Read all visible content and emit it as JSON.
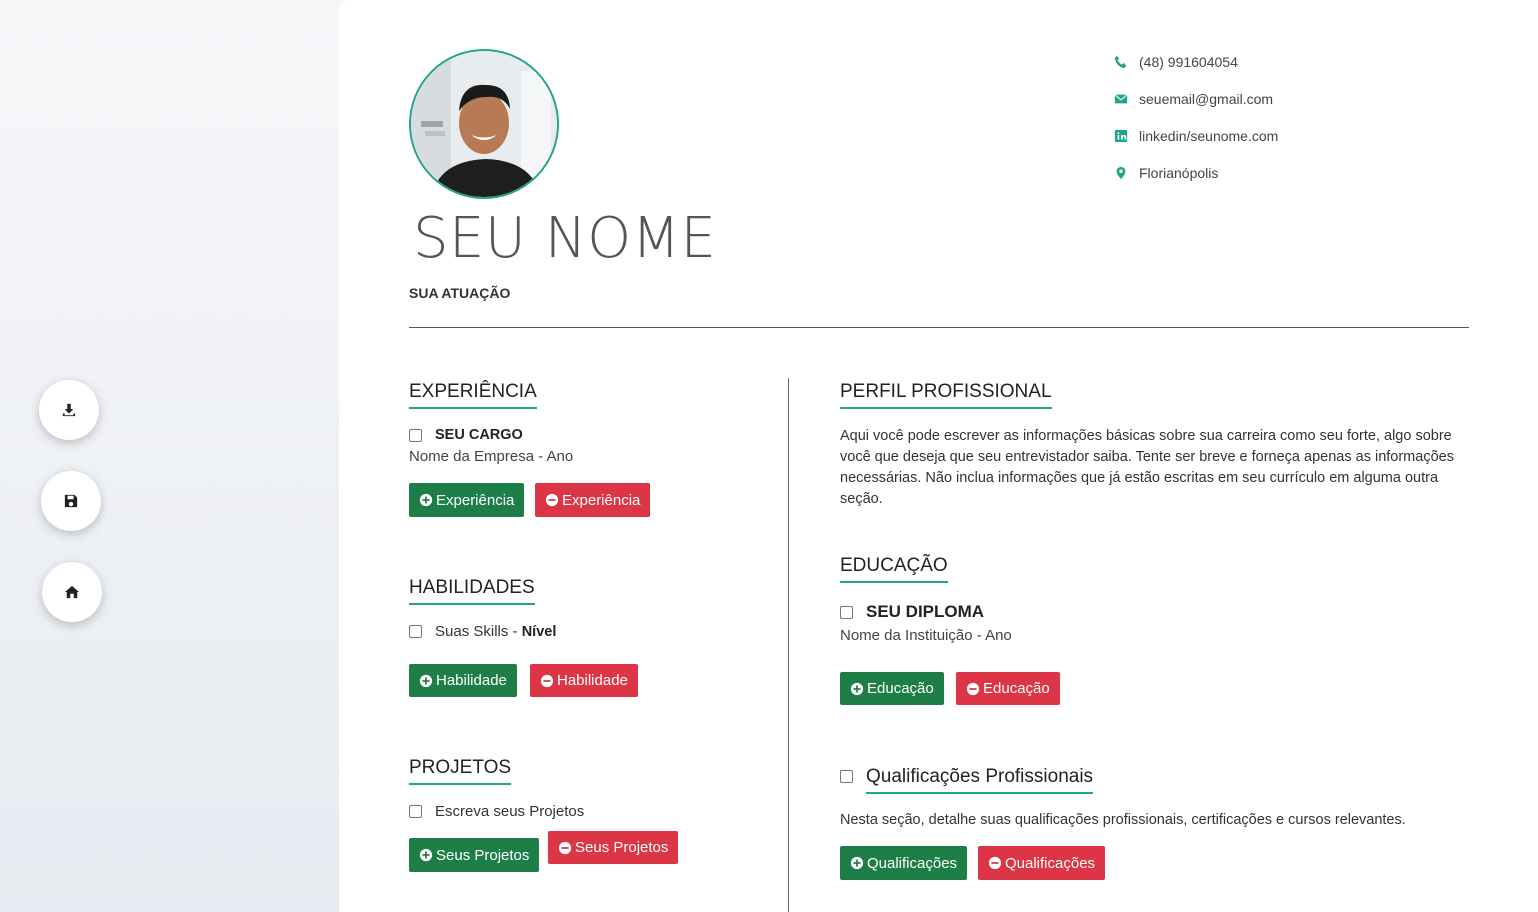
{
  "sidebar": {
    "buttons": [
      {
        "icon": "download-icon"
      },
      {
        "icon": "save-icon"
      },
      {
        "icon": "home-icon"
      }
    ]
  },
  "header": {
    "name": "SEU NOME",
    "role": "SUA ATUAÇÃO",
    "contacts": [
      {
        "icon": "phone-icon",
        "text": "(48) 991604054"
      },
      {
        "icon": "email-icon",
        "text": "seuemail@gmail.com"
      },
      {
        "icon": "linkedin-icon",
        "text": "linkedin/seunome.com"
      },
      {
        "icon": "location-icon",
        "text": "Florianópolis"
      }
    ]
  },
  "experience": {
    "title": "EXPERIÊNCIA",
    "job_title": "SEU CARGO",
    "company": "Nome da Empresa - Ano",
    "add_label": "Experiência",
    "remove_label": "Experiência"
  },
  "skills": {
    "title": "HABILIDADES",
    "skill_text": "Suas Skills - ",
    "level": "Nível",
    "add_label": "Habilidade",
    "remove_label": "Habilidade"
  },
  "projects": {
    "title": "PROJETOS",
    "item": "Escreva seus Projetos",
    "add_label": "Seus Projetos",
    "remove_label": "Seus Projetos"
  },
  "profile": {
    "title": "PERFIL PROFISSIONAL",
    "text": "Aqui você pode escrever as informações básicas sobre sua carreira como seu forte, algo sobre você que deseja que seu entrevistador saiba. Tente ser breve e forneça apenas as informações necessárias. Não inclua informações que já estão escritas em seu currículo em alguma outra seção."
  },
  "education": {
    "title": "EDUCAÇÃO",
    "degree": "SEU DIPLOMA",
    "institution": "Nome da Instituição - Ano",
    "add_label": "Educação",
    "remove_label": "Educação"
  },
  "qualifications": {
    "title": "Qualificações Profissionais",
    "text": "Nesta seção, detalhe suas qualificações profissionais, certificações e cursos relevantes.",
    "add_label": "Qualificações",
    "remove_label": "Qualificações"
  },
  "colors": {
    "accent": "#1fa58a",
    "green_button": "#1e7e48",
    "red_button": "#dc3545"
  }
}
